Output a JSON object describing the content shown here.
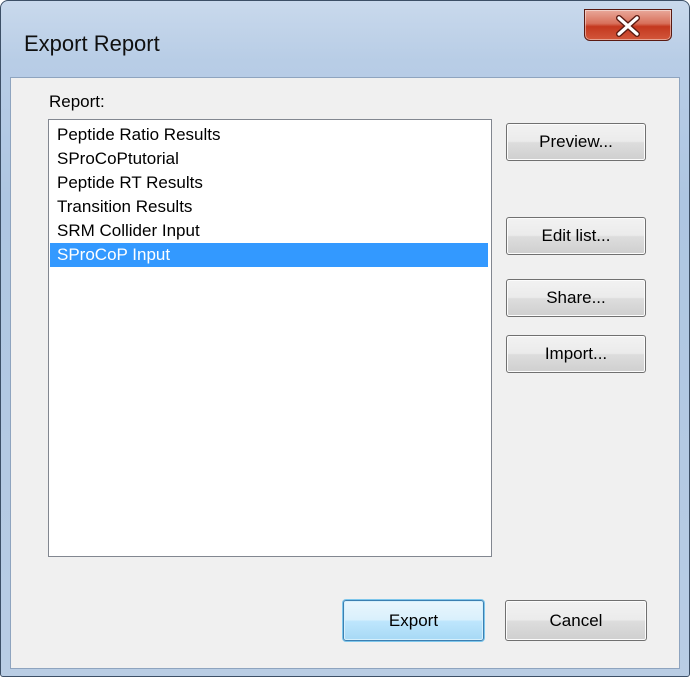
{
  "window": {
    "title": "Export Report",
    "close_icon": "close-icon"
  },
  "report": {
    "label": "Report:",
    "items": [
      "Peptide Ratio Results",
      "SProCoPtutorial",
      "Peptide RT Results",
      "Transition Results",
      "SRM Collider Input",
      "SProCoP Input"
    ],
    "selected": "SProCoP Input"
  },
  "buttons": {
    "preview": "Preview...",
    "edit_list": "Edit list...",
    "share": "Share...",
    "import": "Import...",
    "export": "Export",
    "cancel": "Cancel"
  },
  "colors": {
    "selection": "#3399ff",
    "close_button": "#c4381f"
  }
}
